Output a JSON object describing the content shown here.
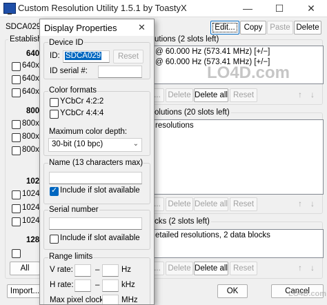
{
  "window": {
    "title": "Custom Resolution Utility 1.5.1 by ToastyX",
    "minimize": "—",
    "maximize": "☐",
    "close": "✕"
  },
  "toolbar": {
    "display_select": "SDCA029",
    "edit": "Edit...",
    "copy": "Copy",
    "paste": "Paste",
    "delete": "Delete"
  },
  "established": {
    "label": "Establish",
    "headers": [
      "640",
      "800",
      "1024",
      "1280"
    ],
    "items": [
      "640x",
      "640x",
      "640x",
      "800x",
      "800x",
      "800x",
      "1024",
      "1024",
      "1024"
    ],
    "all_button": "All"
  },
  "detailed": {
    "label": "utions (2 slots left)",
    "rows": [
      "@ 60.000 Hz (573.41 MHz) [+/−]",
      "@ 60.000 Hz (573.41 MHz) [+/−]"
    ],
    "buttons": {
      "add": "...",
      "delete": "Delete",
      "delete_all": "Delete all",
      "reset": "Reset"
    }
  },
  "standard": {
    "label": "olutions (20 slots left)",
    "rows": [
      "resolutions"
    ],
    "buttons": {
      "add": "...",
      "delete": "Delete",
      "delete_all": "Delete all",
      "reset": "Reset"
    }
  },
  "extension": {
    "label": "cks (2 slots left)",
    "rows": [
      "etailed resolutions, 2 data blocks"
    ],
    "buttons": {
      "add": "...",
      "delete": "Delete",
      "delete_all": "Delete all",
      "reset": "Reset"
    }
  },
  "footer": {
    "import": "Import...",
    "ok": "OK",
    "cancel": "Cancel"
  },
  "watermark": "LO4D.com",
  "dialog": {
    "title": "Display Properties",
    "close": "✕",
    "device_id": {
      "label": "Device ID",
      "id_label": "ID:",
      "id_value": "SDCA029",
      "reset": "Reset",
      "serial_label": "ID serial #:",
      "serial_value": ""
    },
    "color_formats": {
      "label": "Color formats",
      "ycbcr422": "YCbCr 4:2:2",
      "ycbcr444": "YCbCr 4:4:4",
      "depth_label": "Maximum color depth:",
      "depth_value": "30-bit (10 bpc)"
    },
    "name": {
      "label": "Name (13 characters max)",
      "value": "",
      "include": "Include if slot available"
    },
    "serial_number": {
      "label": "Serial number",
      "value": "",
      "include": "Include if slot available"
    },
    "range_limits": {
      "label": "Range limits",
      "v_rate": "V rate:",
      "v_unit": "Hz",
      "h_rate": "H rate:",
      "h_unit": "kHz",
      "max_clock": "Max pixel clock:",
      "clock_unit": "MHz",
      "dash": "–"
    }
  }
}
